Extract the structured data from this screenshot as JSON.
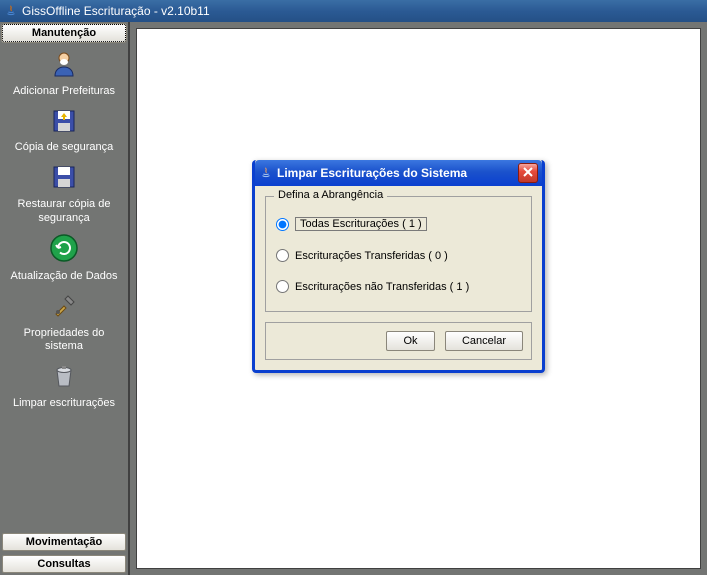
{
  "window": {
    "title": "GissOffline Escrituração - v2.10b11"
  },
  "sidebar": {
    "tabs": {
      "manutencao": "Manutenção",
      "movimentacao": "Movimentação",
      "consultas": "Consultas"
    },
    "items": [
      {
        "label": "Adicionar Prefeituras"
      },
      {
        "label": "Cópia de segurança"
      },
      {
        "label": "Restaurar cópia de segurança"
      },
      {
        "label": "Atualização de Dados"
      },
      {
        "label": "Propriedades do sistema"
      },
      {
        "label": "Limpar escriturações"
      }
    ]
  },
  "dialog": {
    "title": "Limpar Escriturações do Sistema",
    "group_legend": "Defina a Abrangência",
    "options": {
      "todas": "Todas Escriturações ( 1 )",
      "transferidas": "Escriturações Transferidas ( 0 )",
      "nao_transferidas": "Escriturações não Transferidas ( 1 )"
    },
    "buttons": {
      "ok": "Ok",
      "cancel": "Cancelar"
    }
  }
}
